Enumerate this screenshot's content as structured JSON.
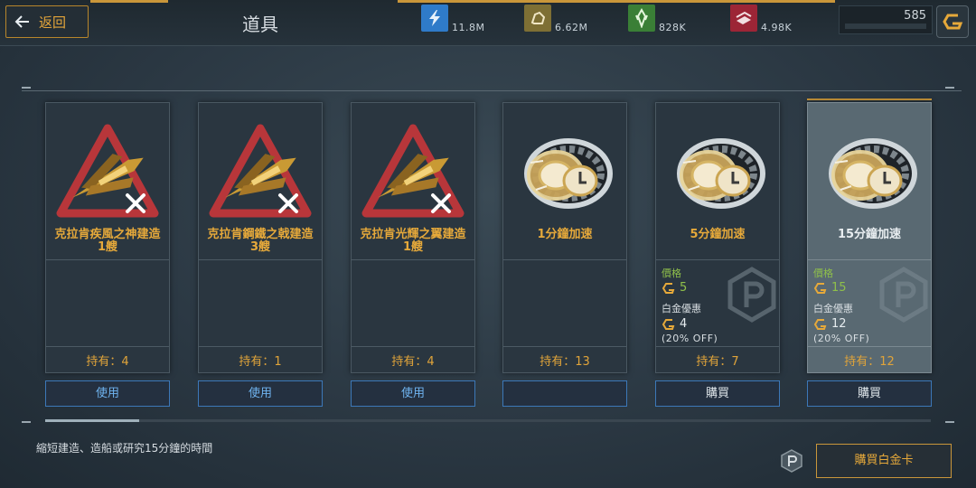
{
  "header": {
    "back_label": "返回",
    "title": "道具"
  },
  "resources": [
    {
      "icon": "energy-icon",
      "value": "11.8M",
      "color": "#2f7bc9"
    },
    {
      "icon": "ore-icon",
      "value": "6.62M",
      "color": "#8a7a3a"
    },
    {
      "icon": "crystal-icon",
      "value": "828K",
      "color": "#3f8a3a"
    },
    {
      "icon": "alloy-icon",
      "value": "4.98K",
      "color": "#a8293a"
    }
  ],
  "gold": {
    "value": "585"
  },
  "items": [
    {
      "name": "克拉肯疾風之神建造\n1艘",
      "held": "持有：4",
      "action": "使用",
      "type": "ship"
    },
    {
      "name": "克拉肯鋼鐵之戟建造\n3艘",
      "held": "持有：1",
      "action": "使用",
      "type": "ship"
    },
    {
      "name": "克拉肯光輝之翼建造\n1艘",
      "held": "持有：4",
      "action": "使用",
      "type": "ship"
    },
    {
      "name": "1分鐘加速",
      "held": "持有：13",
      "action": "",
      "type": "speedup"
    },
    {
      "name": "5分鐘加速",
      "held": "持有：7",
      "action": "購買",
      "type": "speedup",
      "price_label": "價格",
      "price": "5",
      "vip_label": "白金優惠",
      "vip_price": "4",
      "off": "(20% OFF)"
    },
    {
      "name": "15分鐘加速",
      "held": "持有：12",
      "action": "購買",
      "type": "speedup",
      "price_label": "價格",
      "price": "15",
      "vip_label": "白金優惠",
      "vip_price": "12",
      "off": "(20% OFF)"
    }
  ],
  "footer": {
    "description": "縮短建造、造船或研究15分鐘的時間",
    "buy_vip_label": "購買白金卡"
  }
}
